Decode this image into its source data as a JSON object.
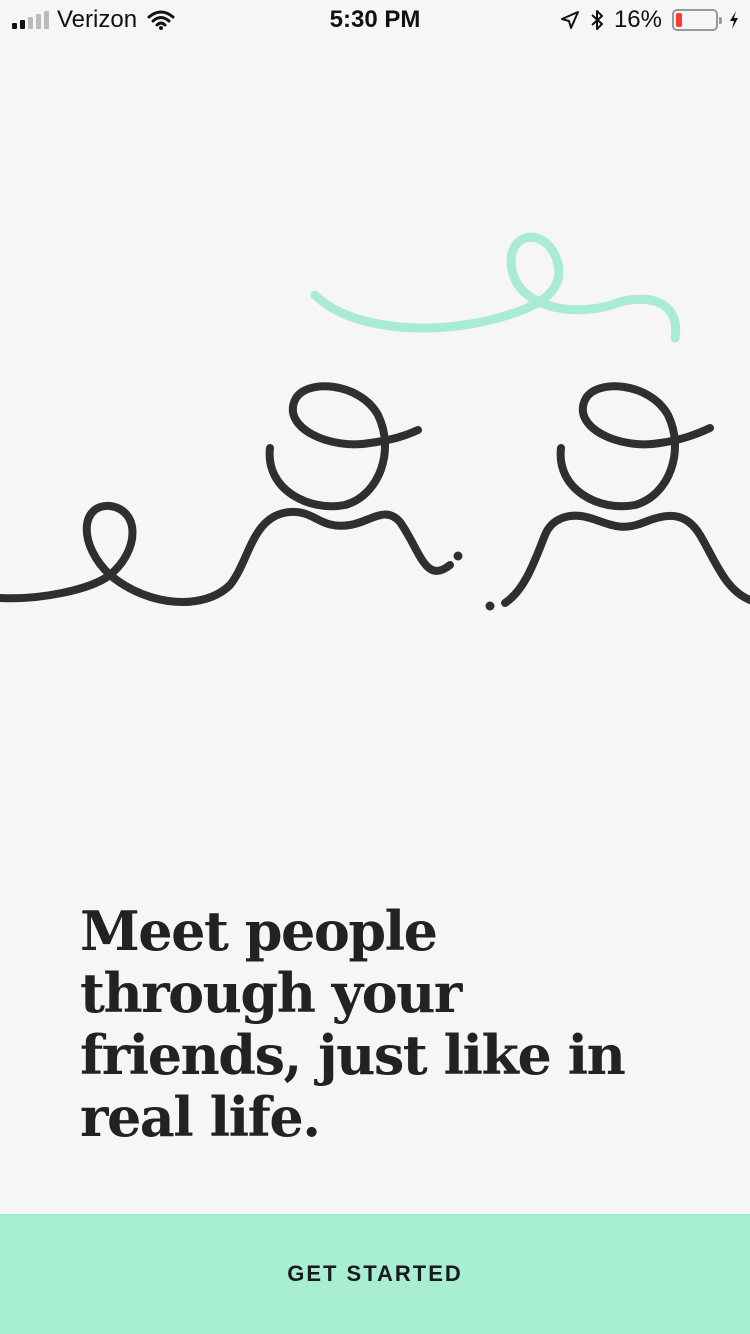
{
  "status_bar": {
    "carrier": "Verizon",
    "time": "5:30 PM",
    "battery_percent": "16%",
    "battery_level": 0.16,
    "signal_bars": 2,
    "icons": [
      "wifi-icon",
      "location-arrow-icon",
      "bluetooth-icon",
      "battery-icon",
      "charging-bolt-icon"
    ]
  },
  "colors": {
    "background": "#f6f6f6",
    "accent_mint": "#a7eed3",
    "scribble_mint": "#a9ebd3",
    "ink": "#2f2f2f",
    "battery_low": "#ff3b30"
  },
  "onboarding": {
    "headline": "Meet people through your friends, just like in real life.",
    "cta_label": "GET STARTED"
  }
}
